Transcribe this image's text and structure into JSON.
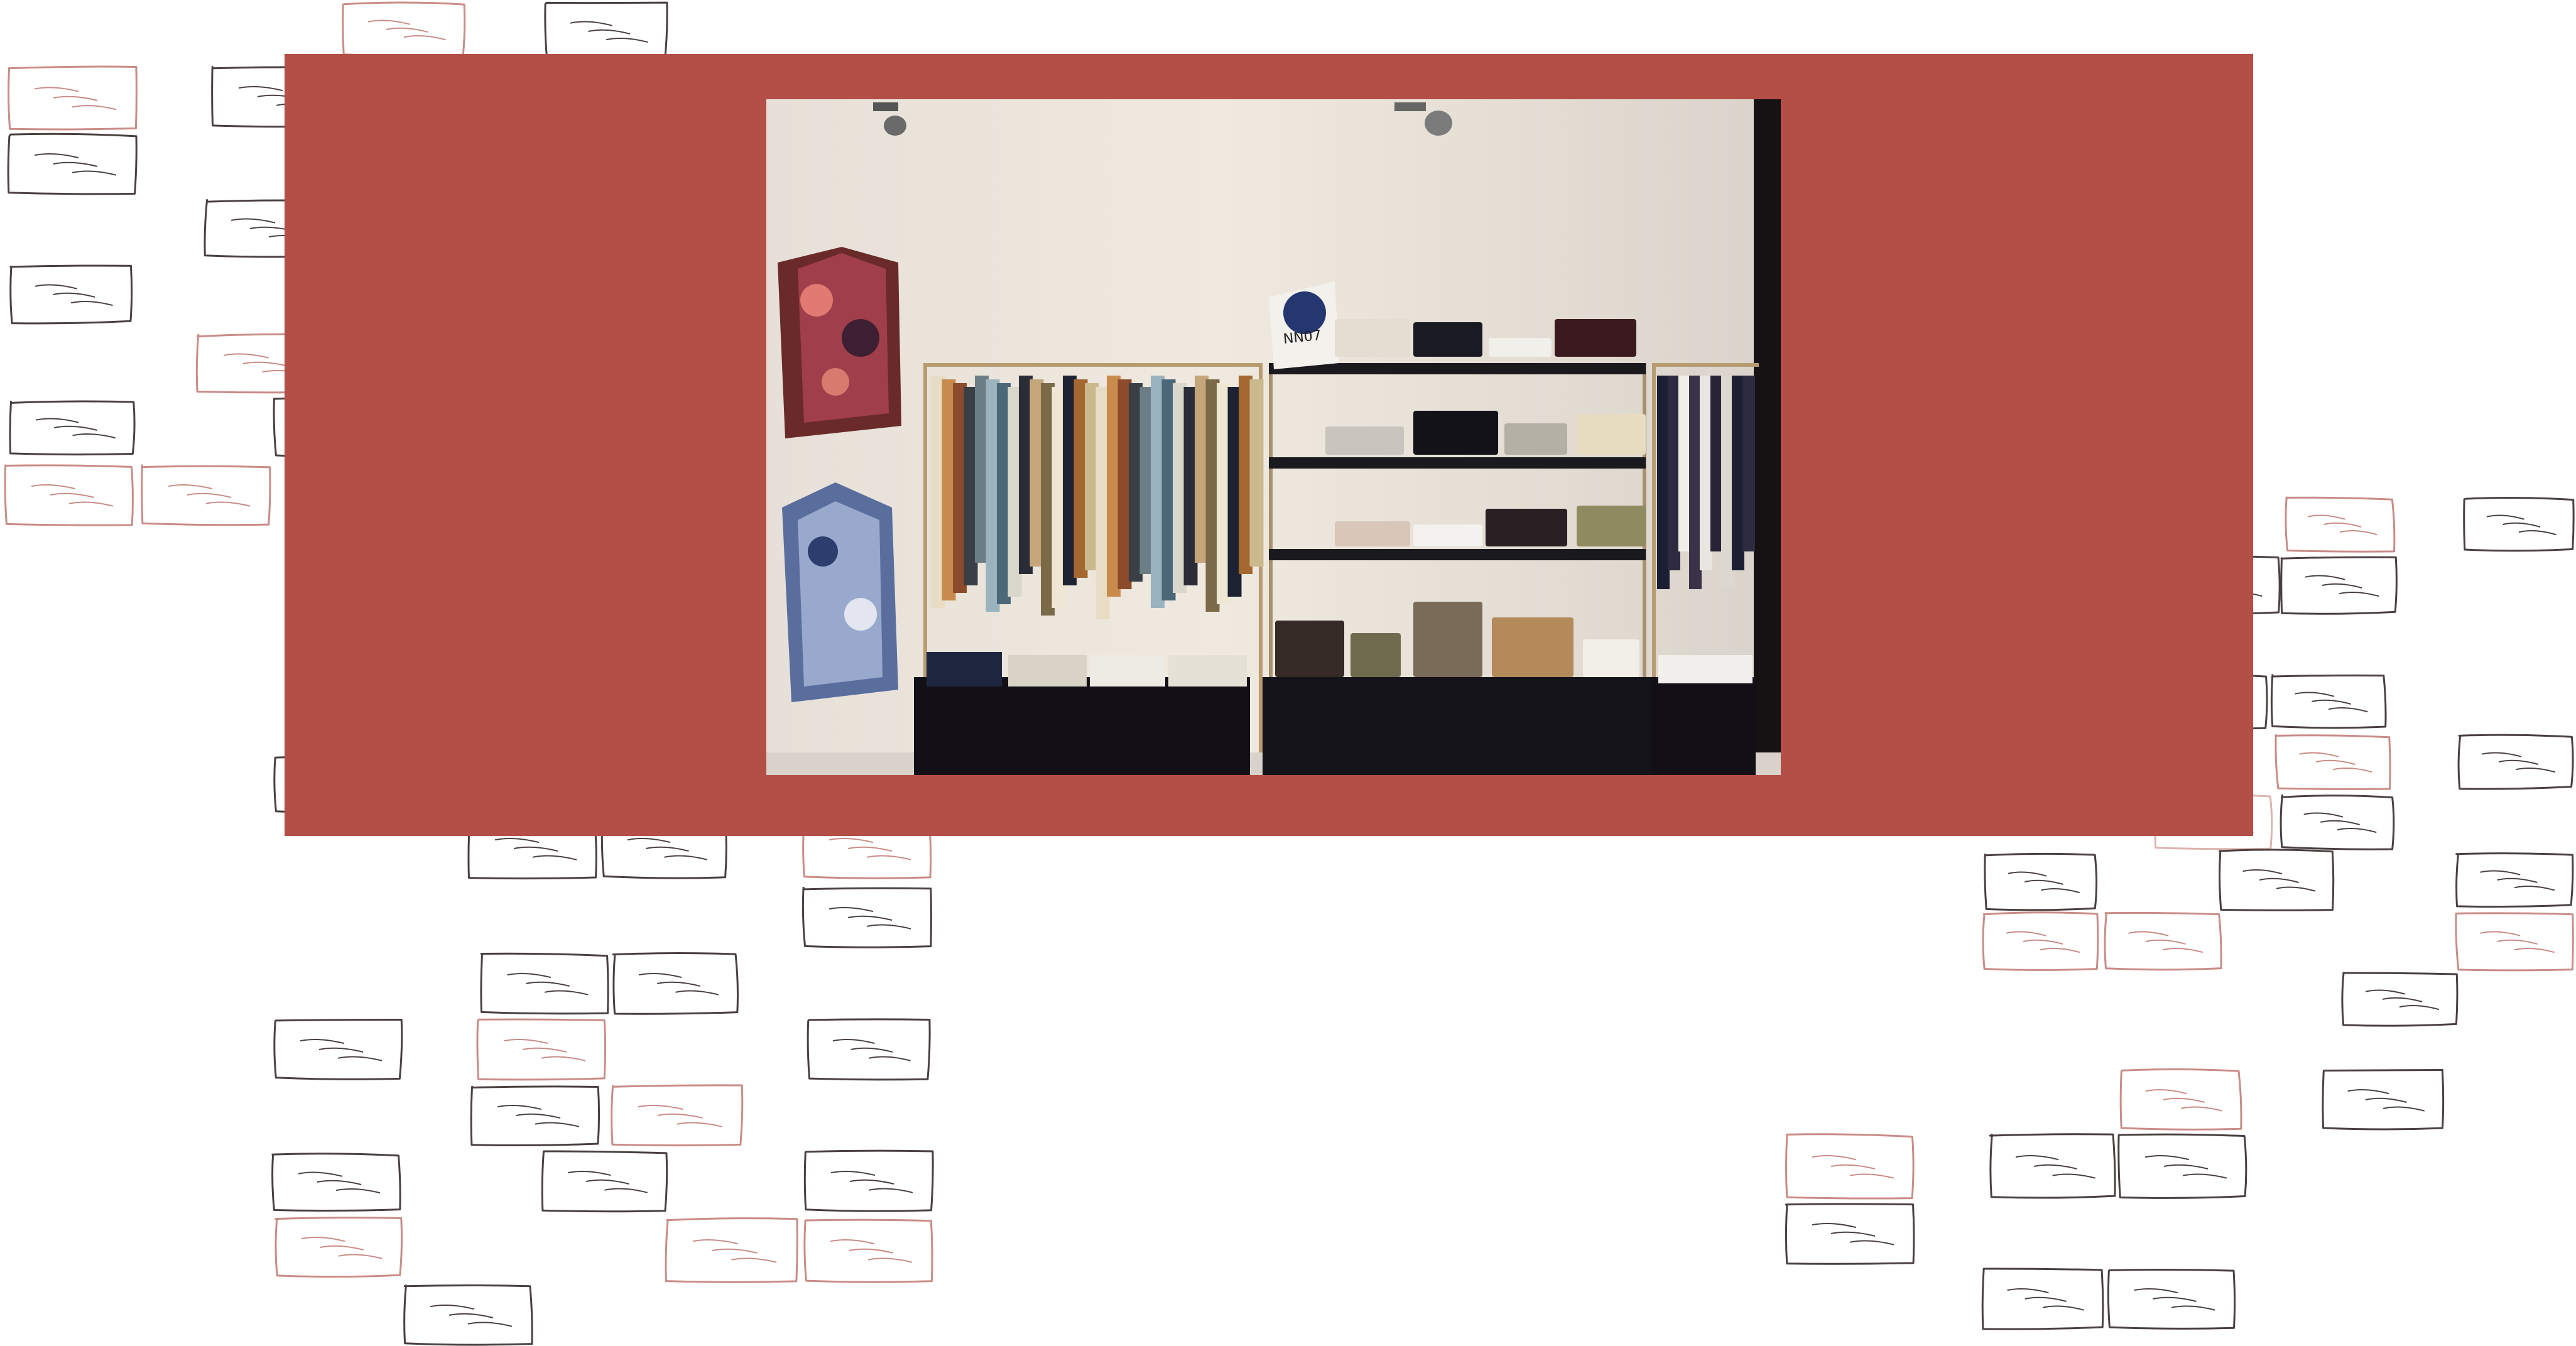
{
  "colors": {
    "panel": "#b34f47",
    "brick_dark": "#4a4040",
    "brick_pink": "#c98c86",
    "brick_faint": "#dcb4ae",
    "background": "#ffffff"
  },
  "photo": {
    "sign_text": "NN07",
    "subject_icons": [
      "store-wall-photo",
      "clothing-rack-icon",
      "shelf-icon",
      "security-camera-icon"
    ]
  }
}
